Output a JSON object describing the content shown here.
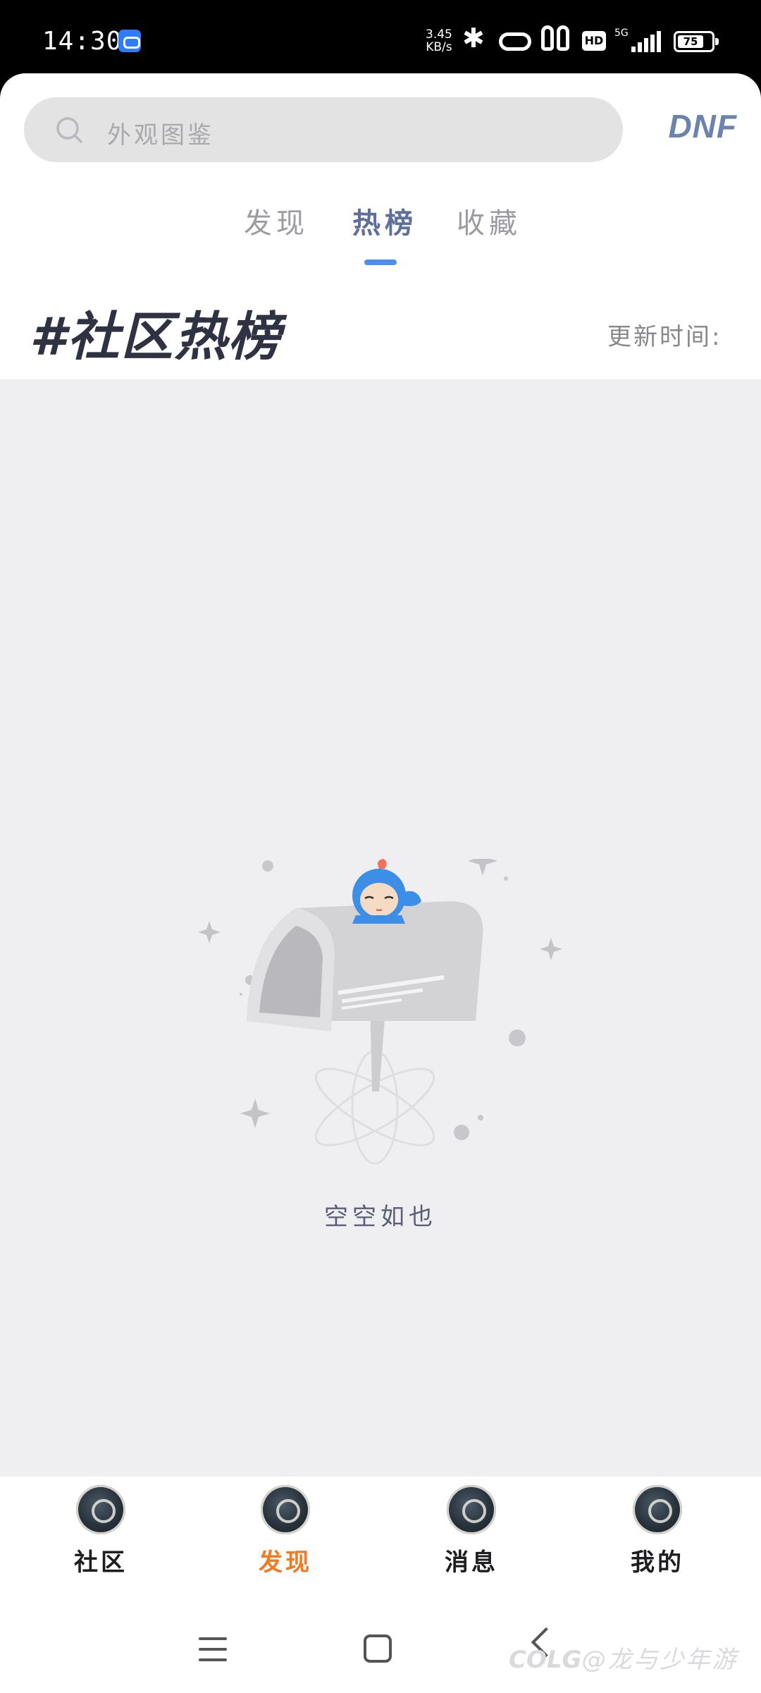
{
  "status_bar": {
    "time": "14:30",
    "net_speed_value": "3.45",
    "net_speed_unit": "KB/s",
    "hd": "HD",
    "network": "5G",
    "battery": "75"
  },
  "search": {
    "placeholder": "外观图鉴",
    "brand": "DNF"
  },
  "tabs": [
    {
      "label": "发现",
      "active": false
    },
    {
      "label": "热榜",
      "active": true
    },
    {
      "label": "收藏",
      "active": false
    }
  ],
  "hot_section": {
    "title": "#社区热榜",
    "update_label": "更新时间:"
  },
  "empty_state": {
    "text": "空空如也"
  },
  "bottom_nav": [
    {
      "label": "社区",
      "icon": "community-icon",
      "active": false
    },
    {
      "label": "发现",
      "icon": "discover-icon",
      "active": true
    },
    {
      "label": "消息",
      "icon": "messages-icon",
      "active": false
    },
    {
      "label": "我的",
      "icon": "profile-icon",
      "active": false
    }
  ],
  "watermark": {
    "brand": "COLG",
    "text": "@龙与少年游"
  },
  "colors": {
    "accent": "#4d8ef0",
    "active_nav": "#f07a1f",
    "background": "#efeff1"
  }
}
